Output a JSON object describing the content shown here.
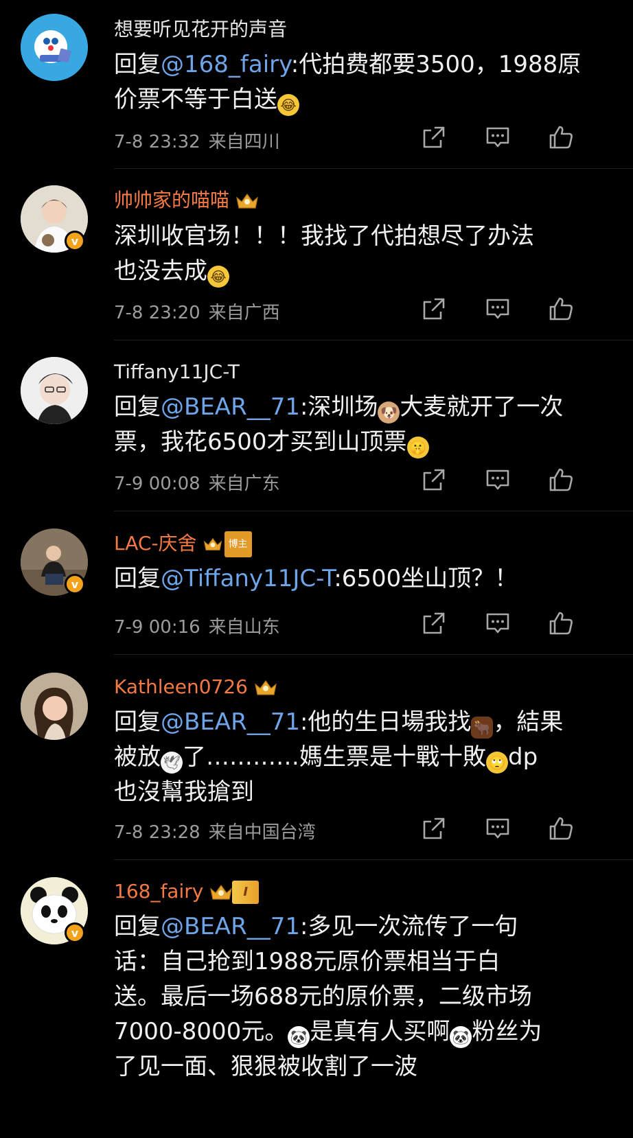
{
  "comments": [
    {
      "user": "想要听见花开的声音",
      "reply_prefix": "回复",
      "mention": "@168_fairy",
      "text_line1": ":代拍费都要3500，1988原",
      "text_line2": "价票不等于白送",
      "emoji1": "😂",
      "time": "7-8 23:32",
      "location": "来自四川"
    },
    {
      "user": "帅帅家的喵喵",
      "badge_verified": "v",
      "text_line1": "深圳收官场！！！我找了代拍想尽了办法",
      "text_line2": "也没去成",
      "emoji1": "😂",
      "time": "7-8 23:20",
      "location": "来自广西"
    },
    {
      "user": "Tiffany11JC-T",
      "reply_prefix": "回复",
      "mention": "@BEAR__71",
      "text_line1_a": ":深圳场",
      "emoji_dog": "🐶",
      "text_line1_b": "大麦就开了一次",
      "text_line2": "票，我花6500才买到山顶票",
      "emoji2": "🤫",
      "time": "7-9 00:08",
      "location": "来自广东"
    },
    {
      "user": "LAC-庆舍",
      "tag": "博主",
      "badge_verified": "v",
      "reply_prefix": "回复",
      "mention": "@Tiffany11JC-T",
      "text_line1": ":6500坐山顶？！",
      "time": "7-9 00:16",
      "location": "来自山东"
    },
    {
      "user": "Kathleen0726",
      "reply_prefix": "回复",
      "mention": "@BEAR__71",
      "text_line1_a": ":他的生日場我找",
      "emoji_cow": "🐂",
      "text_line1_b": "，結果",
      "text_line2_a": "被放",
      "emoji_dove": "🕊",
      "text_line2_b": "了…………媽生票是十戰十敗",
      "emoji_eye": "🙄",
      "text_line2_c": "dp",
      "text_line3": "也沒幫我搶到",
      "time": "7-8 23:28",
      "location": "来自中国台湾"
    },
    {
      "user": "168_fairy",
      "level": "I",
      "badge_verified": "v",
      "reply_prefix": "回复",
      "mention": "@BEAR__71",
      "text_line1": ":多见一次流传了一句",
      "text_line2": "话：自己抢到1988元原价票相当于白",
      "text_line3": "送。最后一场688元的原价票，二级市场",
      "text_line4_a": "7000-8000元。",
      "emoji_panda": "🐼",
      "text_line4_b": "是真有人买啊",
      "text_line4_c": "粉丝为",
      "text_line5": "了见一面、狠狠被收割了一波"
    }
  ],
  "icons": {
    "share": "share-icon",
    "comment": "comment-icon",
    "like": "like-icon"
  },
  "colors": {
    "mention": "#6ea4e8",
    "vip_name": "#f47a45",
    "meta": "#9c9c9c",
    "verified_badge": "#f3a21b"
  }
}
